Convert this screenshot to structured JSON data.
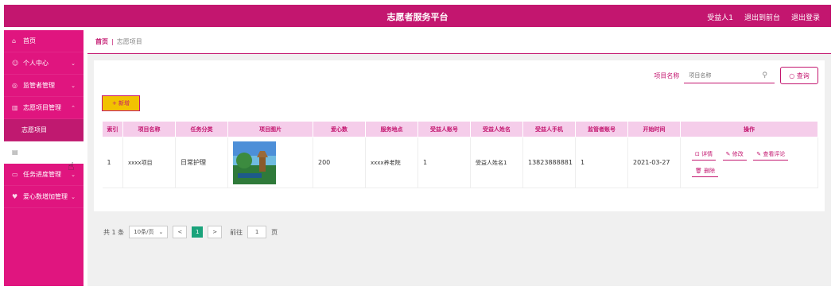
{
  "header": {
    "title": "志愿者服务平台",
    "user": "受益人1",
    "exit_to_front": "退出到前台",
    "logout": "退出登录"
  },
  "sidebar": {
    "items": [
      {
        "label": "首页",
        "icon": "home-icon"
      },
      {
        "label": "个人中心",
        "icon": "user-icon"
      },
      {
        "label": "监管者管理",
        "icon": "settings-icon"
      },
      {
        "label": "志愿项目管理",
        "icon": "chart-icon"
      },
      {
        "label": "志愿项目",
        "icon": ""
      },
      {
        "label": "",
        "icon": "doc-icon"
      },
      {
        "label": "任务进度管理",
        "icon": "task-icon"
      },
      {
        "label": "爱心数增加管理",
        "icon": "heart-icon"
      }
    ]
  },
  "breadcrumb": {
    "home": "首页",
    "sep": "|",
    "current": "志愿项目"
  },
  "search": {
    "label": "项目名称",
    "placeholder": "项目名称",
    "button": "○ 查询"
  },
  "add_button": "+ 新增",
  "table": {
    "headers": [
      "索引",
      "项目名称",
      "任务分类",
      "项目图片",
      "爱心数",
      "服务地点",
      "受益人账号",
      "受益人姓名",
      "受益人手机",
      "监管者账号",
      "开始时间",
      "操作"
    ],
    "rows": [
      {
        "index": "1",
        "name": "xxxx项目",
        "category": "日常护理",
        "love": "200",
        "place": "xxxx养老院",
        "account": "1",
        "username": "受益人姓名1",
        "phone": "13823888881",
        "supervisor": "1",
        "start": "2021-03-27"
      }
    ],
    "ops": {
      "detail": "⊡ 详情",
      "edit": "✎ 修改",
      "review": "✎ 查看评论",
      "delete": "🗑 删除"
    }
  },
  "pagination": {
    "total": "共 1 条",
    "page_size": "10条/页",
    "prev": "<",
    "current": "1",
    "next": ">",
    "goto_label": "前往",
    "goto_value": "1",
    "page_unit": "页"
  },
  "colors": {
    "primary": "#c3166f",
    "sidebar": "#e0157f",
    "header_row": "#f5cdea",
    "add_button": "#f2c200",
    "page_active": "#1aa37b"
  }
}
